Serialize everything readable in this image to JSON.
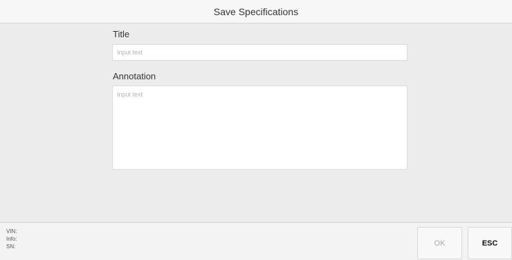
{
  "header": {
    "title": "Save Specifications"
  },
  "form": {
    "title_label": "Title",
    "title_placeholder": "Input text",
    "title_value": "",
    "annotation_label": "Annotation",
    "annotation_placeholder": "Input text",
    "annotation_value": ""
  },
  "footer": {
    "vin_label": "VIN:",
    "info_label": "Info:",
    "sn_label": "SN:",
    "ok_label": "OK",
    "esc_label": "ESC"
  }
}
